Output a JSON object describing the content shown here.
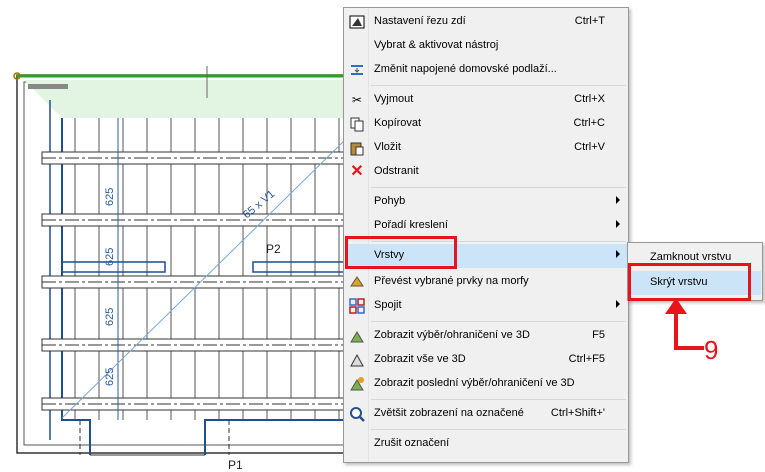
{
  "drawing": {
    "dims": [
      "625",
      "625",
      "625",
      "625"
    ],
    "diagonal_label": "65 x V1",
    "labels": {
      "p2": "P2",
      "p1": "P1"
    }
  },
  "menu": {
    "items": [
      {
        "label": "Nastavení řezu zdí",
        "shortcut": "Ctrl+T",
        "icon": "wall-cut-icon"
      },
      {
        "label": "Vybrat & aktivovat nástroj",
        "shortcut": "",
        "icon": ""
      },
      {
        "label": "Změnit napojené domovské podlaží...",
        "shortcut": "",
        "icon": "story-link-icon"
      },
      {
        "label": "Vyjmout",
        "shortcut": "Ctrl+X",
        "icon": "scissors-icon"
      },
      {
        "label": "Kopírovat",
        "shortcut": "Ctrl+C",
        "icon": "copy-icon"
      },
      {
        "label": "Vložit",
        "shortcut": "Ctrl+V",
        "icon": "paste-icon"
      },
      {
        "label": "Odstranit",
        "shortcut": "",
        "icon": "delete-icon"
      },
      {
        "label": "Pohyb",
        "shortcut": "",
        "icon": ""
      },
      {
        "label": "Pořadí kreslení",
        "shortcut": "",
        "icon": ""
      },
      {
        "label": "Vrstvy",
        "shortcut": "",
        "icon": ""
      },
      {
        "label": "Převést vybrané prvky na morfy",
        "shortcut": "",
        "icon": "morph-icon"
      },
      {
        "label": "Spojit",
        "shortcut": "",
        "icon": "merge-icon"
      },
      {
        "label": "Zobrazit výběr/ohraničení ve 3D",
        "shortcut": "F5",
        "icon": "show-3d-selection-icon"
      },
      {
        "label": "Zobrazit vše ve 3D",
        "shortcut": "Ctrl+F5",
        "icon": "show-all-3d-icon"
      },
      {
        "label": "Zobrazit poslední výběr/ohraničení ve 3D",
        "shortcut": "",
        "icon": "show-last-3d-icon"
      },
      {
        "label": "Zvětšit zobrazení na označené",
        "shortcut": "Ctrl+Shift+'",
        "icon": "zoom-selection-icon"
      },
      {
        "label": "Zrušit označení",
        "shortcut": "",
        "icon": ""
      }
    ]
  },
  "submenu": {
    "items": [
      {
        "label": "Zamknout vrstvu"
      },
      {
        "label": "Skrýt vrstvu"
      }
    ]
  },
  "callout": {
    "number": "9"
  },
  "colors": {
    "accent_red": "#e8141b",
    "highlight": "#cce4f7",
    "plan_blue": "#2b5a9e",
    "green": "#27a327"
  }
}
